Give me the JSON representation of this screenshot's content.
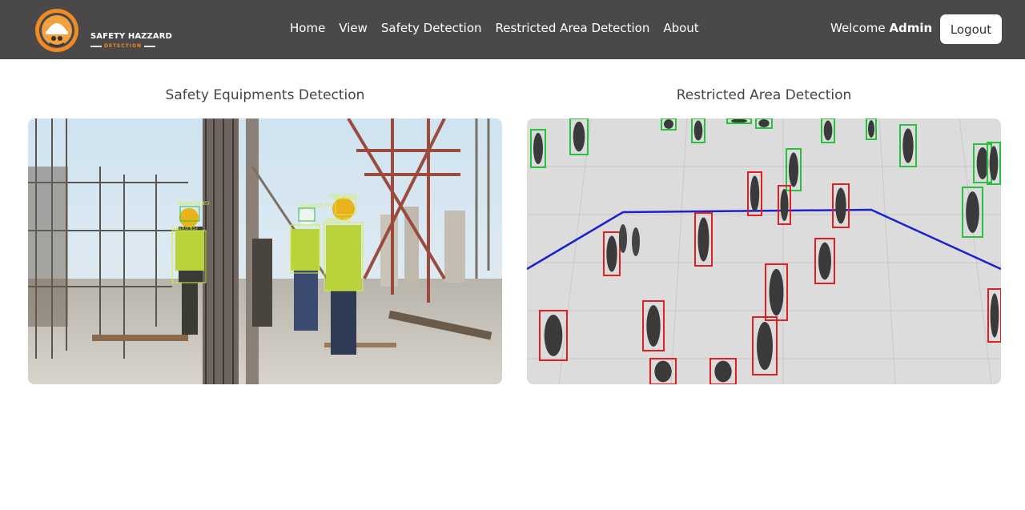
{
  "brand": {
    "name": "SAFETY HAZZARD",
    "subtitle": "DETECTION"
  },
  "nav": {
    "items": [
      "Home",
      "View",
      "Safety Detection",
      "Restricted Area Detection",
      "About"
    ]
  },
  "user": {
    "welcome_prefix": "Welcome",
    "name": "Admin",
    "logout_label": "Logout"
  },
  "cards": {
    "left_title": "Safety Equipments Detection",
    "right_title": "Restricted Area Detection"
  },
  "detections": {
    "labels": [
      "Helmet(0.77)",
      "Helmet(0.8)",
      "Helmet(0.85)",
      "Vest(0.85)",
      "Vest(0.88)"
    ]
  },
  "colors": {
    "navbar": "#4a4849",
    "accent": "#f08a24",
    "box_safe": "#27c23a",
    "box_alert": "#e02020",
    "boundary_line": "#1a22cc",
    "detect_label": "#d6ef3a"
  }
}
